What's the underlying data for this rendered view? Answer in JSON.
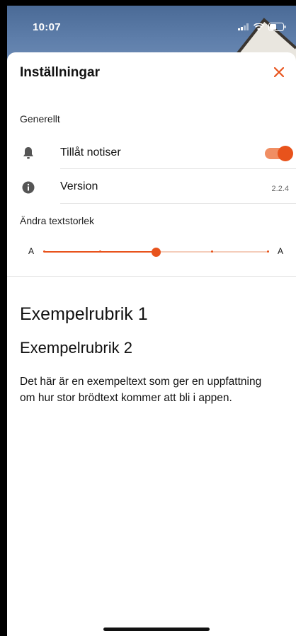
{
  "status_bar": {
    "time": "10:07"
  },
  "header": {
    "title": "Inställningar",
    "close_icon": "close-icon"
  },
  "general": {
    "section_label": "Generellt",
    "notifications": {
      "label": "Tillåt notiser",
      "icon": "bell-icon",
      "enabled": true
    },
    "version": {
      "label": "Version",
      "icon": "info-icon",
      "value": "2.2.4"
    }
  },
  "text_size": {
    "section_label": "Ändra textstorlek",
    "small_label": "A",
    "large_label": "A",
    "steps": 5,
    "selected_step": 2
  },
  "preview": {
    "heading1": "Exempelrubrik 1",
    "heading2": "Exempelrubrik 2",
    "body": "Det här är en exempeltext som ger en uppfattning om hur stor brödtext kommer att bli i appen."
  },
  "colors": {
    "accent": "#e8531c",
    "accent_light": "#f08e63"
  }
}
